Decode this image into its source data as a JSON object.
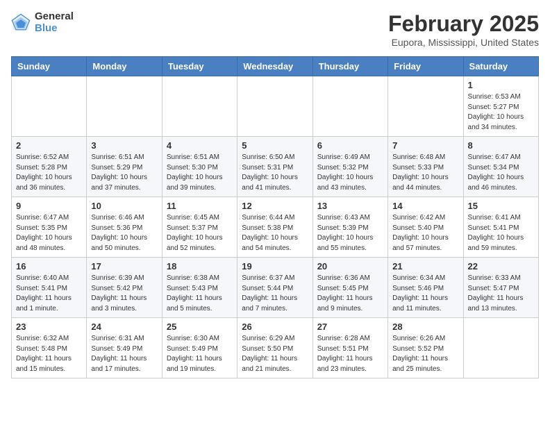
{
  "logo": {
    "general": "General",
    "blue": "Blue"
  },
  "title": "February 2025",
  "location": "Eupora, Mississippi, United States",
  "weekdays": [
    "Sunday",
    "Monday",
    "Tuesday",
    "Wednesday",
    "Thursday",
    "Friday",
    "Saturday"
  ],
  "weeks": [
    [
      {
        "day": "",
        "info": ""
      },
      {
        "day": "",
        "info": ""
      },
      {
        "day": "",
        "info": ""
      },
      {
        "day": "",
        "info": ""
      },
      {
        "day": "",
        "info": ""
      },
      {
        "day": "",
        "info": ""
      },
      {
        "day": "1",
        "info": "Sunrise: 6:53 AM\nSunset: 5:27 PM\nDaylight: 10 hours and 34 minutes."
      }
    ],
    [
      {
        "day": "2",
        "info": "Sunrise: 6:52 AM\nSunset: 5:28 PM\nDaylight: 10 hours and 36 minutes."
      },
      {
        "day": "3",
        "info": "Sunrise: 6:51 AM\nSunset: 5:29 PM\nDaylight: 10 hours and 37 minutes."
      },
      {
        "day": "4",
        "info": "Sunrise: 6:51 AM\nSunset: 5:30 PM\nDaylight: 10 hours and 39 minutes."
      },
      {
        "day": "5",
        "info": "Sunrise: 6:50 AM\nSunset: 5:31 PM\nDaylight: 10 hours and 41 minutes."
      },
      {
        "day": "6",
        "info": "Sunrise: 6:49 AM\nSunset: 5:32 PM\nDaylight: 10 hours and 43 minutes."
      },
      {
        "day": "7",
        "info": "Sunrise: 6:48 AM\nSunset: 5:33 PM\nDaylight: 10 hours and 44 minutes."
      },
      {
        "day": "8",
        "info": "Sunrise: 6:47 AM\nSunset: 5:34 PM\nDaylight: 10 hours and 46 minutes."
      }
    ],
    [
      {
        "day": "9",
        "info": "Sunrise: 6:47 AM\nSunset: 5:35 PM\nDaylight: 10 hours and 48 minutes."
      },
      {
        "day": "10",
        "info": "Sunrise: 6:46 AM\nSunset: 5:36 PM\nDaylight: 10 hours and 50 minutes."
      },
      {
        "day": "11",
        "info": "Sunrise: 6:45 AM\nSunset: 5:37 PM\nDaylight: 10 hours and 52 minutes."
      },
      {
        "day": "12",
        "info": "Sunrise: 6:44 AM\nSunset: 5:38 PM\nDaylight: 10 hours and 54 minutes."
      },
      {
        "day": "13",
        "info": "Sunrise: 6:43 AM\nSunset: 5:39 PM\nDaylight: 10 hours and 55 minutes."
      },
      {
        "day": "14",
        "info": "Sunrise: 6:42 AM\nSunset: 5:40 PM\nDaylight: 10 hours and 57 minutes."
      },
      {
        "day": "15",
        "info": "Sunrise: 6:41 AM\nSunset: 5:41 PM\nDaylight: 10 hours and 59 minutes."
      }
    ],
    [
      {
        "day": "16",
        "info": "Sunrise: 6:40 AM\nSunset: 5:41 PM\nDaylight: 11 hours and 1 minute."
      },
      {
        "day": "17",
        "info": "Sunrise: 6:39 AM\nSunset: 5:42 PM\nDaylight: 11 hours and 3 minutes."
      },
      {
        "day": "18",
        "info": "Sunrise: 6:38 AM\nSunset: 5:43 PM\nDaylight: 11 hours and 5 minutes."
      },
      {
        "day": "19",
        "info": "Sunrise: 6:37 AM\nSunset: 5:44 PM\nDaylight: 11 hours and 7 minutes."
      },
      {
        "day": "20",
        "info": "Sunrise: 6:36 AM\nSunset: 5:45 PM\nDaylight: 11 hours and 9 minutes."
      },
      {
        "day": "21",
        "info": "Sunrise: 6:34 AM\nSunset: 5:46 PM\nDaylight: 11 hours and 11 minutes."
      },
      {
        "day": "22",
        "info": "Sunrise: 6:33 AM\nSunset: 5:47 PM\nDaylight: 11 hours and 13 minutes."
      }
    ],
    [
      {
        "day": "23",
        "info": "Sunrise: 6:32 AM\nSunset: 5:48 PM\nDaylight: 11 hours and 15 minutes."
      },
      {
        "day": "24",
        "info": "Sunrise: 6:31 AM\nSunset: 5:49 PM\nDaylight: 11 hours and 17 minutes."
      },
      {
        "day": "25",
        "info": "Sunrise: 6:30 AM\nSunset: 5:49 PM\nDaylight: 11 hours and 19 minutes."
      },
      {
        "day": "26",
        "info": "Sunrise: 6:29 AM\nSunset: 5:50 PM\nDaylight: 11 hours and 21 minutes."
      },
      {
        "day": "27",
        "info": "Sunrise: 6:28 AM\nSunset: 5:51 PM\nDaylight: 11 hours and 23 minutes."
      },
      {
        "day": "28",
        "info": "Sunrise: 6:26 AM\nSunset: 5:52 PM\nDaylight: 11 hours and 25 minutes."
      },
      {
        "day": "",
        "info": ""
      }
    ]
  ]
}
